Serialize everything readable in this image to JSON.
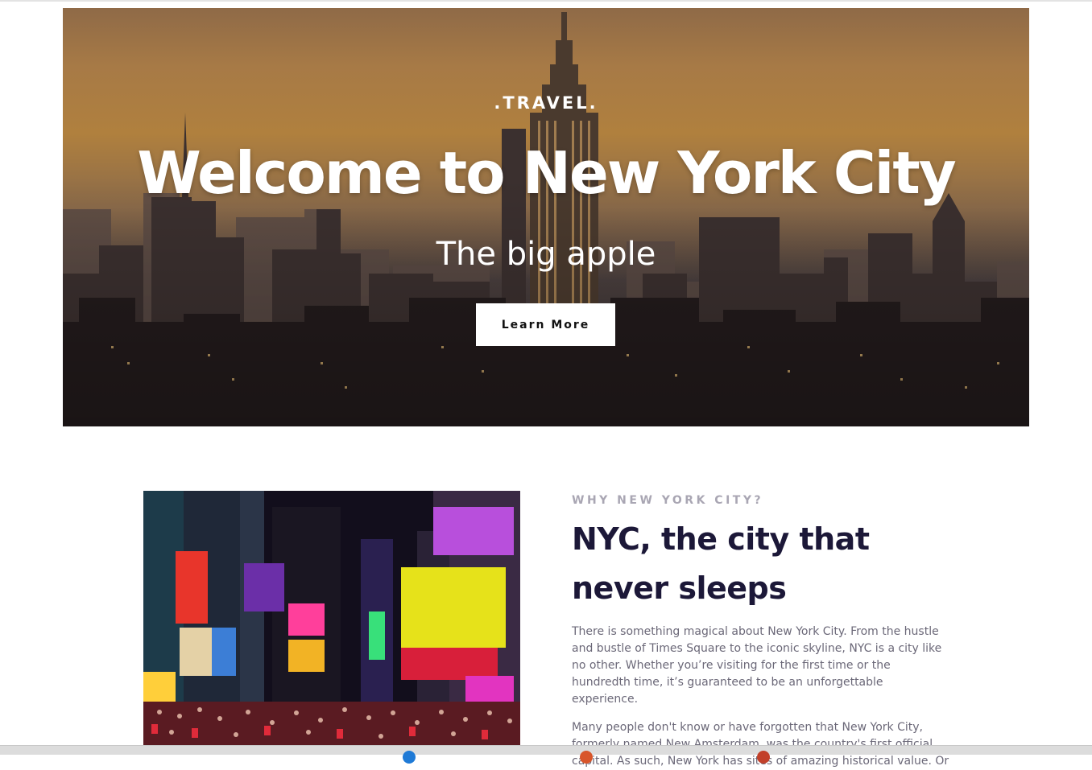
{
  "hero": {
    "kicker": ".TRAVEL.",
    "title": "Welcome to New York City",
    "subtitle": "The big apple",
    "button_label": "Learn More"
  },
  "about": {
    "eyebrow": "WHY NEW YORK CITY?",
    "title": "NYC, the city that never sleeps",
    "paragraphs": [
      "There is something magical about New York City. From the hustle and bustle of Times Square to the iconic skyline, NYC is a city like no other. Whether you’re visiting for the first time or the hundredth time, it’s guaranteed to be an unforgettable experience.",
      "Many people don't know or have forgotten that New York City, formerly named New Amsterdam, was the country's first official capital. As such, New York has sites of amazing historical value. Or"
    ]
  },
  "colors": {
    "heading": "#1c1838",
    "eyebrow": "#a9a6b3",
    "body_text": "#6b6878",
    "hero_sky": "#b0803e"
  }
}
